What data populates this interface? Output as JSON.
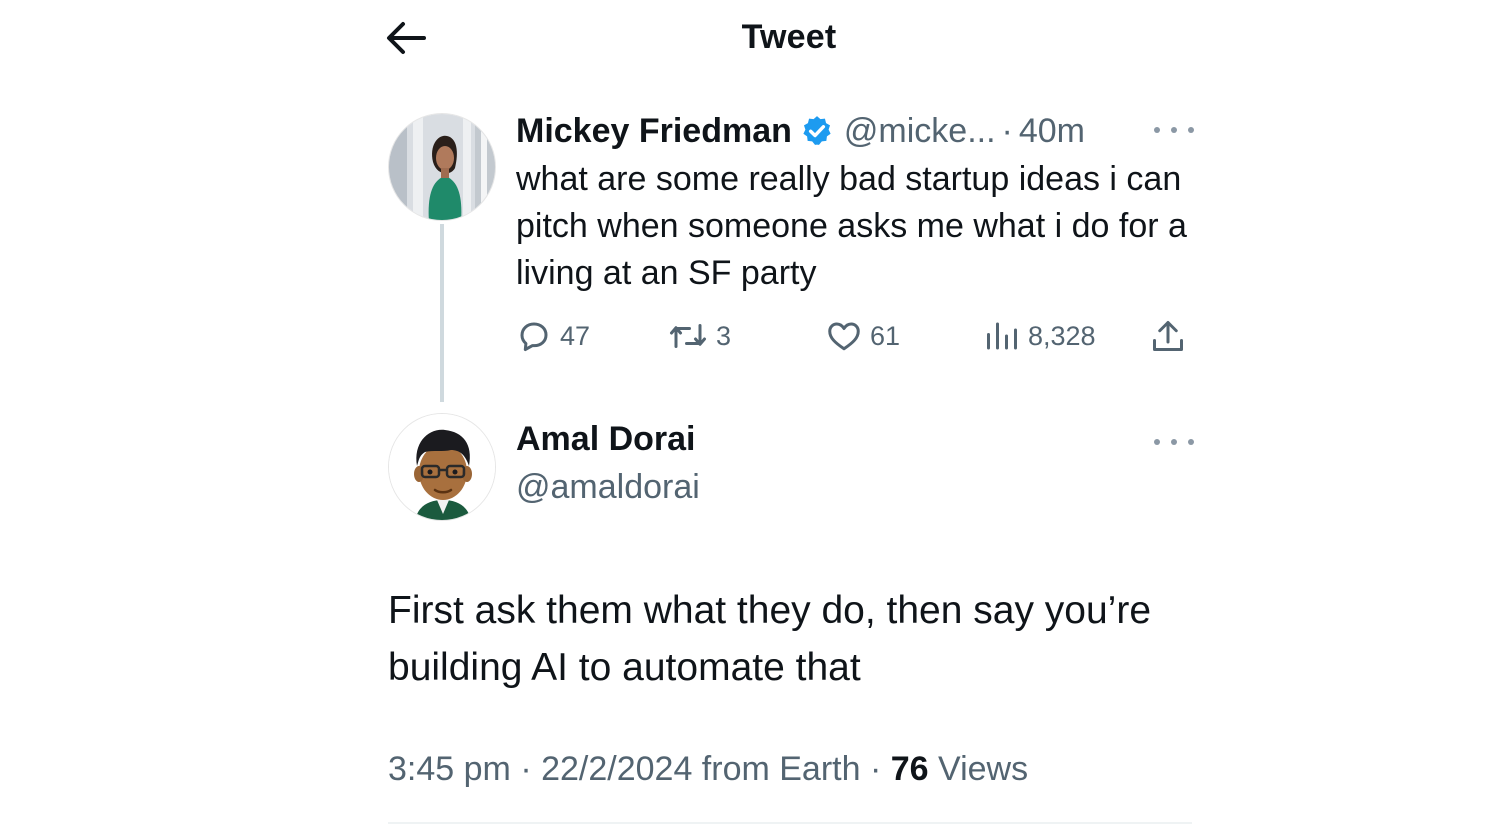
{
  "header": {
    "title": "Tweet",
    "back_icon": "arrow-left-icon"
  },
  "original_tweet": {
    "author_name": "Mickey Friedman",
    "verified": true,
    "verified_color": "#1d9bf0",
    "handle": "@micke...",
    "separator": "·",
    "time_ago": "40m",
    "text": "what are some really bad startup ideas i can pitch when someone asks me what i do for a living at an SF party",
    "stats": {
      "replies": "47",
      "retweets": "3",
      "likes": "61",
      "views": "8,328"
    }
  },
  "reply_tweet": {
    "author_name": "Amal Dorai",
    "handle": "@amaldorai",
    "text": "First ask them what they do, then say you’re building AI to automate that",
    "time": "3:45 pm",
    "separator": "·",
    "date": "22/2/2024 from Earth",
    "views_count": "76",
    "views_label": "Views"
  },
  "colors": {
    "text_primary": "#0f1419",
    "text_secondary": "#536471",
    "thread_line": "#cfd9de",
    "verified": "#1d9bf0"
  }
}
